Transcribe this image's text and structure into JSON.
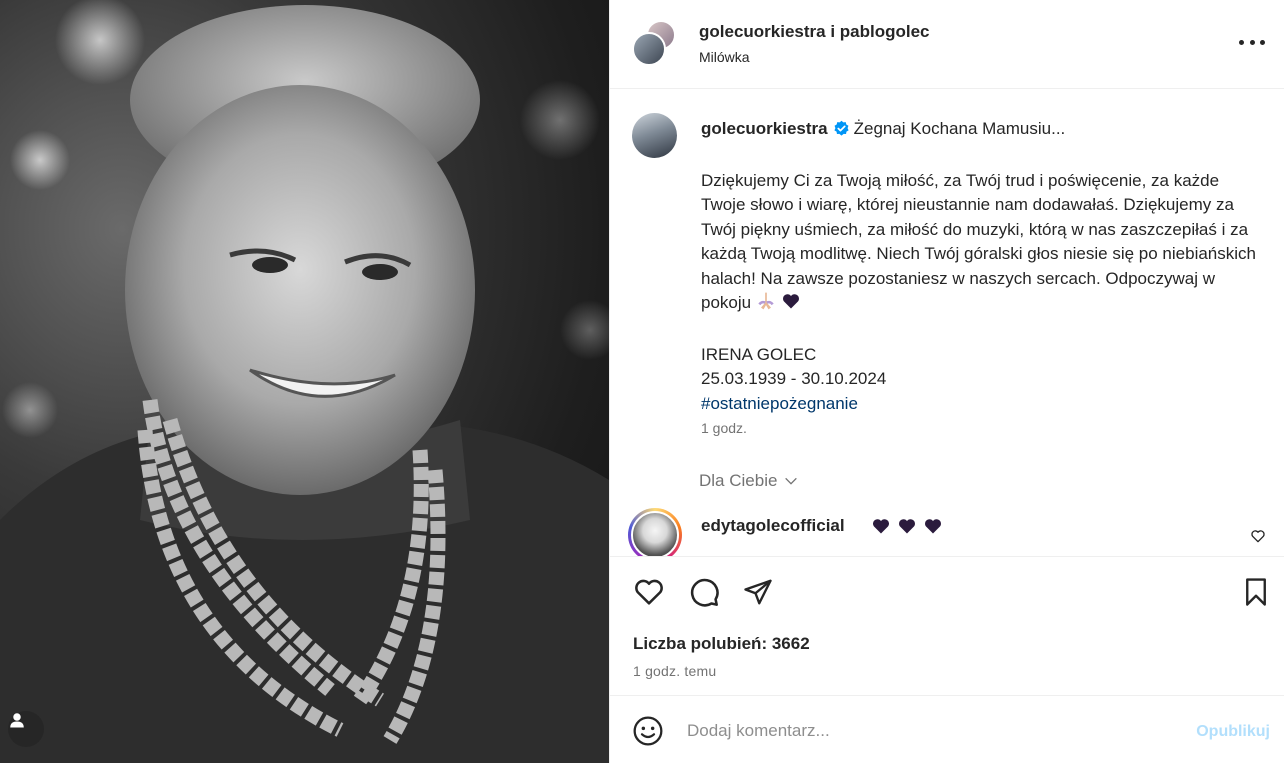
{
  "header": {
    "title": "golecuorkiestra i pablogolec",
    "location": "Milówka"
  },
  "caption": {
    "username": "golecuorkiestra",
    "headline": "Żegnaj Kochana Mamusiu...",
    "paragraph": "Dziękujemy Ci za Twoją miłość, za Twój trud i poświęcenie, za każde Twoje słowo i wiarę, której nieustannie nam dodawałaś. Dziękujemy za Twój piękny uśmiech, za miłość do muzyki, którą w nas zaszczepiłaś i za każdą Twoją modlitwę. Niech Twój góralski głos niesie się po niebiańskich halach! Na zawsze pozostaniesz w naszych sercach. Odpoczywaj w pokoju",
    "name": "IRENA GOLEC",
    "dates": "25.03.1939 - 30.10.2024",
    "hashtag": "#ostatniepożegnanie",
    "time": "1 godz."
  },
  "for_you_label": "Dla Ciebie",
  "comment": {
    "username": "edytagolecofficial"
  },
  "likes": "Liczba polubień: 3662",
  "time_ago": "1 godz. temu",
  "comment_bar": {
    "placeholder": "Dodaj komentarz...",
    "post_label": "Opublikuj"
  },
  "colors": {
    "text": "#262626",
    "secondary": "#737373",
    "hashtag": "#00376b",
    "verified": "#0095f6",
    "post_disabled": "#b2dffc",
    "purple_heart": "#2b1b3d"
  },
  "icons": [
    "tag-person-icon",
    "more-options-icon",
    "verified-badge-icon",
    "chevron-down-icon",
    "praying-hands-icon",
    "black-heart-icon",
    "like-icon",
    "comment-icon",
    "share-icon",
    "save-icon",
    "emoji-icon"
  ]
}
